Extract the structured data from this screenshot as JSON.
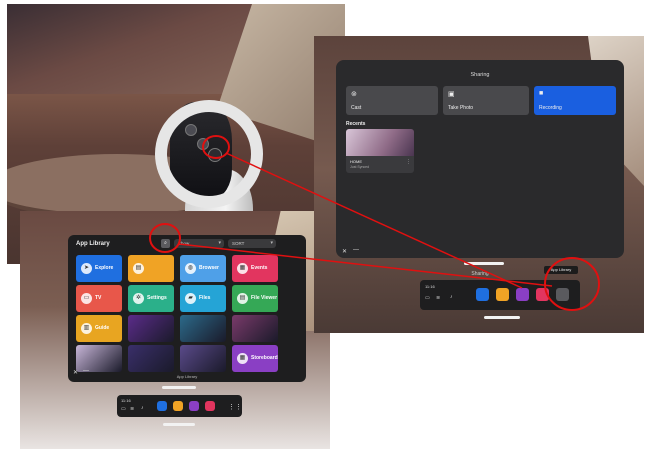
{
  "app_library": {
    "title": "App Library",
    "filter_dropdown": "Show",
    "sort_dropdown": "SORT",
    "footer_label": "App Library",
    "tiles": [
      {
        "label": "Explore",
        "icon": "compass-icon",
        "color": "#1f6fe0"
      },
      {
        "label": "",
        "icon": "store-icon",
        "color": "#f0a325"
      },
      {
        "label": "Browser",
        "icon": "globe-icon",
        "color": "#4fa0e8"
      },
      {
        "label": "Events",
        "icon": "calendar-icon",
        "color": "#e2355f"
      },
      {
        "label": "TV",
        "icon": "tv-icon",
        "color": "#e8574a"
      },
      {
        "label": "Settings",
        "icon": "gear-icon",
        "color": "#2bb08a"
      },
      {
        "label": "Files",
        "icon": "folder-icon",
        "color": "#25a4d6"
      },
      {
        "label": "File Viewer",
        "icon": "file-icon",
        "color": "#35a856"
      },
      {
        "label": "Guide",
        "icon": "book-icon",
        "color": "#e8a521"
      },
      {
        "label": "",
        "icon": "game-thumbnail",
        "color": "#5b2c8a"
      },
      {
        "label": "",
        "icon": "game-thumbnail",
        "color": "#2c6a8a"
      },
      {
        "label": "",
        "icon": "game-thumbnail",
        "color": "#7a3a6a"
      },
      {
        "label": "",
        "icon": "game-thumbnail",
        "color": "#c8b6d8"
      },
      {
        "label": "",
        "icon": "game-thumbnail",
        "color": "#3a2f6a"
      },
      {
        "label": "",
        "icon": "game-thumbnail",
        "color": "#5a4a8a"
      },
      {
        "label": "Storeboards",
        "icon": "grid-icon",
        "color": "#8a3fc4"
      }
    ]
  },
  "dock_small": {
    "time": "11:16",
    "apps": [
      {
        "icon": "explore-icon",
        "color": "#1f6fe0"
      },
      {
        "icon": "store-icon",
        "color": "#f0a325"
      },
      {
        "icon": "people-icon",
        "color": "#8a3fc4"
      },
      {
        "icon": "share-icon",
        "color": "#e2355f"
      }
    ]
  },
  "sharing": {
    "title": "Sharing",
    "buttons": [
      {
        "label": "Cast",
        "icon": "cast-icon"
      },
      {
        "label": "Take Photo",
        "icon": "camera-icon"
      },
      {
        "label": "Recording",
        "icon": "video-icon"
      }
    ],
    "recents_label": "Recents",
    "recent_item": {
      "title": "HOME",
      "subtitle": "Just Synced"
    },
    "footer_label": "Sharing",
    "accent_color": "#1a5fe0"
  },
  "dock_large": {
    "time": "11:16",
    "tooltip": "App Library",
    "apps": [
      {
        "icon": "explore-icon",
        "color": "#1f6fe0"
      },
      {
        "icon": "store-icon",
        "color": "#f0a325"
      },
      {
        "icon": "people-icon",
        "color": "#8a3fc4"
      },
      {
        "icon": "share-icon",
        "color": "#e2355f"
      },
      {
        "icon": "app-library-icon",
        "color": "#5a5a5e"
      }
    ]
  },
  "annotation_color": "#e01010"
}
